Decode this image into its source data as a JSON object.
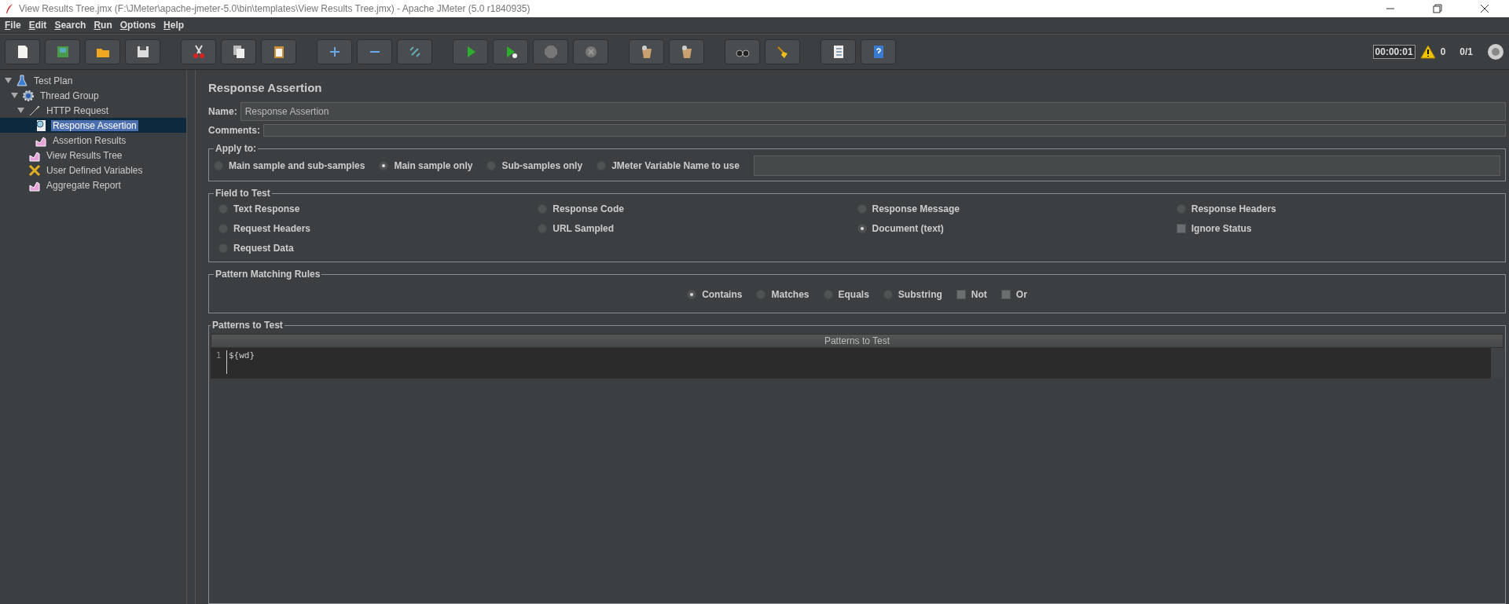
{
  "window": {
    "title": "View Results Tree.jmx (F:\\JMeter\\apache-jmeter-5.0\\bin\\templates\\View Results Tree.jmx) - Apache JMeter (5.0 r1840935)"
  },
  "menu": [
    "File",
    "Edit",
    "Search",
    "Run",
    "Options",
    "Help"
  ],
  "toolbar": {
    "timer": "00:00:01",
    "warnings": "0",
    "threads": "0/1"
  },
  "tree": [
    {
      "label": "Test Plan",
      "kind": "plan",
      "expanded": true,
      "selected": false,
      "children": [
        {
          "label": "Thread Group",
          "kind": "thread-group",
          "expanded": true,
          "selected": false,
          "children": [
            {
              "label": "HTTP Request",
              "kind": "sampler",
              "expanded": true,
              "selected": false,
              "children": [
                {
                  "label": "Response Assertion",
                  "kind": "assertion",
                  "selected": true
                },
                {
                  "label": "Assertion Results",
                  "kind": "listener",
                  "selected": false
                }
              ]
            },
            {
              "label": "View Results Tree",
              "kind": "listener",
              "selected": false
            },
            {
              "label": "User Defined Variables",
              "kind": "config",
              "selected": false
            },
            {
              "label": "Aggregate Report",
              "kind": "listener",
              "selected": false
            }
          ]
        }
      ]
    }
  ],
  "editor": {
    "title": "Response Assertion",
    "name_label": "Name:",
    "name_value": "Response Assertion",
    "comments_label": "Comments:",
    "apply_to": {
      "legend": "Apply to:",
      "options": [
        {
          "label": "Main sample and sub-samples",
          "selected": false
        },
        {
          "label": "Main sample only",
          "selected": true
        },
        {
          "label": "Sub-samples only",
          "selected": false
        },
        {
          "label": "JMeter Variable Name to use",
          "selected": false
        }
      ]
    },
    "field_to_test": {
      "legend": "Field to Test",
      "items": [
        {
          "kind": "radio",
          "label": "Text Response",
          "selected": false
        },
        {
          "kind": "radio",
          "label": "Response Code",
          "selected": false
        },
        {
          "kind": "radio",
          "label": "Response Message",
          "selected": false
        },
        {
          "kind": "radio",
          "label": "Response Headers",
          "selected": false
        },
        {
          "kind": "radio",
          "label": "Request Headers",
          "selected": false
        },
        {
          "kind": "radio",
          "label": "URL Sampled",
          "selected": false
        },
        {
          "kind": "radio",
          "label": "Document (text)",
          "selected": true
        },
        {
          "kind": "checkbox",
          "label": "Ignore Status",
          "checked": false
        },
        {
          "kind": "radio",
          "label": "Request Data",
          "selected": false
        }
      ]
    },
    "pattern_matching": {
      "legend": "Pattern Matching Rules",
      "items": [
        {
          "kind": "radio",
          "label": "Contains",
          "selected": true
        },
        {
          "kind": "radio",
          "label": "Matches",
          "selected": false
        },
        {
          "kind": "radio",
          "label": "Equals",
          "selected": false
        },
        {
          "kind": "radio",
          "label": "Substring",
          "selected": false
        },
        {
          "kind": "checkbox",
          "label": "Not",
          "checked": false
        },
        {
          "kind": "checkbox",
          "label": "Or",
          "checked": false
        }
      ]
    },
    "patterns": {
      "legend": "Patterns to Test",
      "column": "Patterns to Test",
      "rows": [
        {
          "line": "1",
          "text": "${wd}"
        }
      ]
    }
  }
}
